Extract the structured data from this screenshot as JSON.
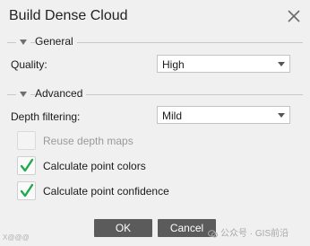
{
  "window": {
    "title": "Build Dense Cloud"
  },
  "general": {
    "title": "General",
    "quality_label": "Quality:",
    "quality_value": "High"
  },
  "advanced": {
    "title": "Advanced",
    "depth_filtering_label": "Depth filtering:",
    "depth_filtering_value": "Mild",
    "reuse_depth_maps": {
      "label": "Reuse depth maps",
      "checked": false,
      "enabled": false
    },
    "calculate_point_colors": {
      "label": "Calculate point colors",
      "checked": true,
      "enabled": true
    },
    "calculate_point_confidence": {
      "label": "Calculate point confidence",
      "checked": true,
      "enabled": true
    }
  },
  "buttons": {
    "ok_label": "OK",
    "cancel_label": "Cancel"
  },
  "watermark": {
    "left_text": "X@@@",
    "right_text": "公众号 · GIS前沿"
  },
  "colors": {
    "button_bg": "#5b5b5b",
    "checkmark": "#22a94a",
    "dialog_bg": "#f0f0f0"
  }
}
